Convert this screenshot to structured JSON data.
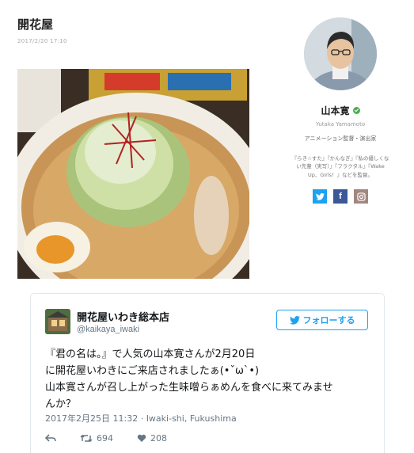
{
  "post": {
    "title": "開花屋",
    "date": "2017/2/20 17:10"
  },
  "profile": {
    "name": "山本寛",
    "roman_name": "Yutaka Yamamoto",
    "role": "アニメーション監督・演出家",
    "bio": "『らき☆すた』『かんなぎ』『私の優しくない先輩（実写）』『フラクタル』『Wake Up、Girls！』などを監督。",
    "social": [
      "twitter-icon",
      "facebook-icon",
      "instagram-icon"
    ]
  },
  "tweet": {
    "display_name": "開花屋いわき総本店",
    "handle": "@kaikaya_iwaki",
    "follow_label": "フォローする",
    "text_lines": [
      "『君の名は。』で人気の山本寛さんが2月20日",
      "に開花屋いわきにご来店されましたぁ(•ˇωˋ•)",
      "山本寛さんが召し上がった生味噌らぁめんを食べに来てみませ",
      "んか？"
    ],
    "timestamp": "2017年2月25日 11:32",
    "separator": "·",
    "location": "Iwaki-shi, Fukushima",
    "retweets": "694",
    "likes": "208"
  },
  "colors": {
    "twitter_blue": "#1da1f2",
    "facebook_blue": "#3b5998",
    "instagram_brown": "#a1887f",
    "verified_green": "#4caf50"
  }
}
